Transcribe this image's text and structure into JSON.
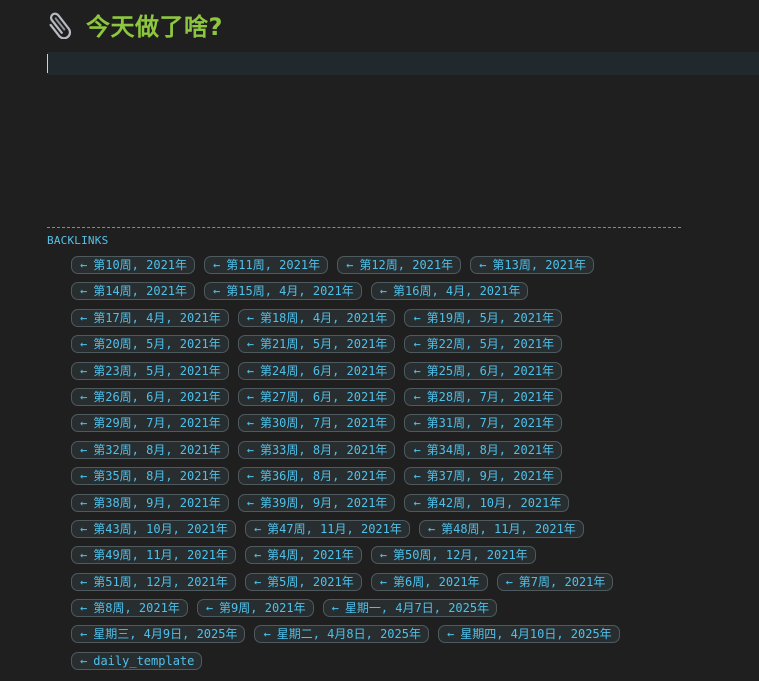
{
  "page": {
    "title": "今天做了啥?",
    "icon": "paperclip-icon"
  },
  "backlinks": {
    "heading": "BACKLINKS",
    "arrow": "←",
    "rows": [
      [
        "第10周, 2021年",
        "第11周, 2021年",
        "第12周, 2021年",
        "第13周, 2021年"
      ],
      [
        "第14周, 2021年",
        "第15周, 4月, 2021年",
        "第16周, 4月, 2021年"
      ],
      [
        "第17周, 4月, 2021年",
        "第18周, 4月, 2021年",
        "第19周, 5月, 2021年"
      ],
      [
        "第20周, 5月, 2021年",
        "第21周, 5月, 2021年",
        "第22周, 5月, 2021年"
      ],
      [
        "第23周, 5月, 2021年",
        "第24周, 6月, 2021年",
        "第25周, 6月, 2021年"
      ],
      [
        "第26周, 6月, 2021年",
        "第27周, 6月, 2021年",
        "第28周, 7月, 2021年"
      ],
      [
        "第29周, 7月, 2021年",
        "第30周, 7月, 2021年",
        "第31周, 7月, 2021年"
      ],
      [
        "第32周, 8月, 2021年",
        "第33周, 8月, 2021年",
        "第34周, 8月, 2021年"
      ],
      [
        "第35周, 8月, 2021年",
        "第36周, 8月, 2021年",
        "第37周, 9月, 2021年"
      ],
      [
        "第38周, 9月, 2021年",
        "第39周, 9月, 2021年",
        "第42周, 10月, 2021年"
      ],
      [
        "第43周, 10月, 2021年",
        "第47周, 11月, 2021年",
        "第48周, 11月, 2021年"
      ],
      [
        "第49周, 11月, 2021年",
        "第4周, 2021年",
        "第50周, 12月, 2021年"
      ],
      [
        "第51周, 12月, 2021年",
        "第5周, 2021年",
        "第6周, 2021年",
        "第7周, 2021年"
      ],
      [
        "第8周, 2021年",
        "第9周, 2021年",
        "星期一, 4月7日, 2025年"
      ],
      [
        "星期三, 4月9日, 2025年",
        "星期二, 4月8日, 2025年",
        "星期四, 4月10日, 2025年"
      ],
      [
        "daily_template"
      ]
    ]
  },
  "colors": {
    "background": "#1f1f1f",
    "title": "#8dc63f",
    "link": "#4fc0ea",
    "chip_border": "#4f5a5e",
    "editor_bg": "#22292c"
  }
}
